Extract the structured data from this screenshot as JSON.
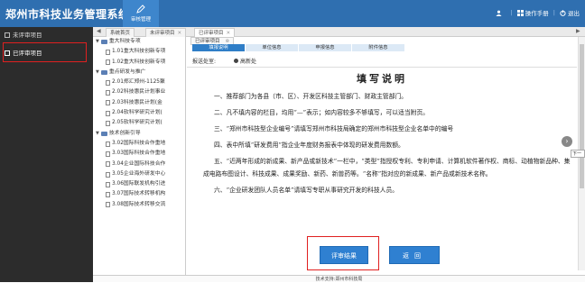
{
  "header": {
    "app_title": "郑州市科技业务管理系统",
    "nav_tab_label": "审核管理",
    "user_name": "",
    "manual_label": "操作手册",
    "logout_label": "退出",
    "separator": "|"
  },
  "sidebar": {
    "items": [
      {
        "label": "未评审项目"
      },
      {
        "label": "已评审项目"
      }
    ]
  },
  "tabbar": {
    "tabs": [
      "系统首页",
      "未评审项目",
      "已评审项目"
    ]
  },
  "tree": {
    "nodes": [
      {
        "label": "重大科技专项",
        "level": 1
      },
      {
        "label": "1.01重大科技创新专项",
        "level": 2
      },
      {
        "label": "1.02重大科技创新专项",
        "level": 2
      },
      {
        "label": "重点研发与推广",
        "level": 1
      },
      {
        "label": "2.01郑汇郑州-1125聚",
        "level": 2
      },
      {
        "label": "2.02科技惠民计划事业",
        "level": 2
      },
      {
        "label": "2.03科技惠民计划(金",
        "level": 2
      },
      {
        "label": "2.04软科学研究计划(",
        "level": 2
      },
      {
        "label": "2.05软科学研究计划(",
        "level": 2
      },
      {
        "label": "技术创新引导",
        "level": 1
      },
      {
        "label": "3.02国际科技合作重地",
        "level": 2
      },
      {
        "label": "3.03国际科技合作重地",
        "level": 2
      },
      {
        "label": "3.04企业国际科技合作",
        "level": 2
      },
      {
        "label": "3.05企业海外研发中心",
        "level": 2
      },
      {
        "label": "3.06国际联发机构引进",
        "level": 2
      },
      {
        "label": "3.07国际技术转移机构",
        "level": 2
      },
      {
        "label": "3.08国际技术转移交流",
        "level": 2
      }
    ]
  },
  "main": {
    "page_tab": "已评审项目",
    "subtabs": [
      "填报说明",
      "单位信息",
      "申报信息",
      "附件信息"
    ],
    "unit_label": "报送处室:",
    "unit_value": "高新处",
    "doc_title": "填写说明",
    "paragraphs": [
      "一、推荐部门为各县（市、区）、开发区科技主管部门、财政主管部门。",
      "二、凡不填内容的栏目，均用“—”表示；如内容较多不够填写，可以适当附页。",
      "三、“郑州市科技型企业编号”请填写郑州市科技局确定的郑州市科技型企业名单中的编号",
      "四、表中所填“研发费用”指企业年度财务报表中体现的研发费用数额。",
      "五、“近两年形成的新成果、新产品或新技术”一栏中，“类型”指授权专利、专利申请、计算机软件著作权、商标、动植物新品种、集成电路布图设计、科技成果、成果奖励、新药、新兽药等。“名称”指对应的新成果、新产品或新技术名称。",
      "六、“企业研发团队人员名单”请填写专职从事研究开发的科技人员。"
    ],
    "btn_result": "评审结果",
    "btn_back": "返回",
    "side_tip": "下一"
  },
  "footer": {
    "text": "技术支持:郑州市科技局"
  },
  "colors": {
    "header_bg": "#2f6fb0",
    "sidebar_bg": "#2c2c2c",
    "accent": "#2f80d1",
    "highlight": "#e02020"
  }
}
